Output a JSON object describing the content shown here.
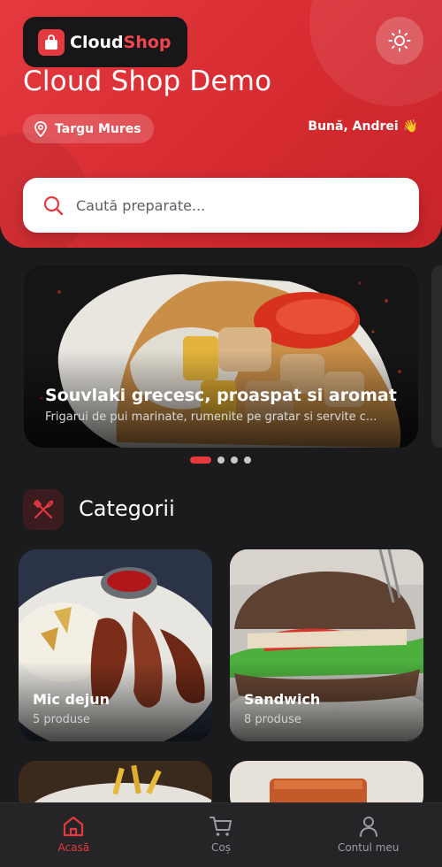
{
  "brand": {
    "part1": "Cloud",
    "part2": "Shop",
    "accent": "#e43a3f"
  },
  "header": {
    "title": "Cloud Shop Demo",
    "location": "Targu Mures",
    "greeting": "Bună, Andrei 👋"
  },
  "search": {
    "placeholder": "Caută preparate..."
  },
  "banner": {
    "title": "Souvlaki grecesc, proaspat si aromat",
    "subtitle": "Frigarui de pui marinate, rumenite pe gratar si servite c...",
    "slide_count": 4,
    "active_slide": 1
  },
  "categories": {
    "title": "Categorii",
    "items": [
      {
        "name": "Mic dejun",
        "count": "5 produse"
      },
      {
        "name": "Sandwich",
        "count": "8 produse"
      }
    ]
  },
  "nav": {
    "items": [
      {
        "label": "Acasă",
        "active": true
      },
      {
        "label": "Coș",
        "active": false
      },
      {
        "label": "Contul meu",
        "active": false
      }
    ]
  },
  "icons": {
    "logo": "shopping-bag-icon",
    "theme": "sun-icon",
    "location": "map-pin-icon",
    "search": "search-icon",
    "categories": "utensils-crossed-icon",
    "home": "home-icon",
    "cart": "cart-icon",
    "account": "user-icon"
  }
}
